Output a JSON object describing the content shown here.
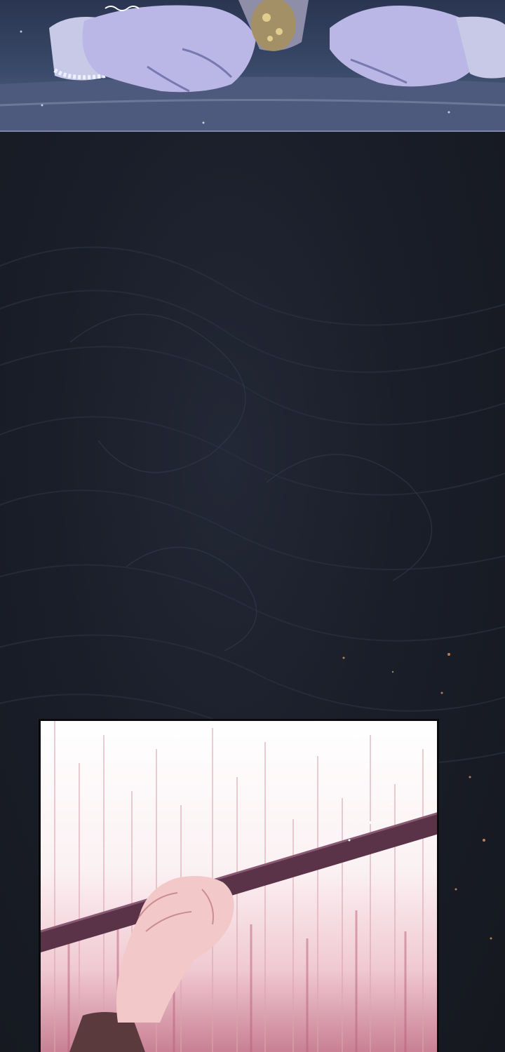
{
  "panels": [
    {
      "scene": "hands-on-table"
    },
    {
      "scene": "dark-swirl-background"
    },
    {
      "scene": "hand-gripping-staff"
    }
  ],
  "colors": {
    "night_blue": "#3a4a6a",
    "dark_bg": "#1a1e29",
    "panel_white": "#ffffff",
    "speed_line_pink": "#c98094",
    "staff_purple": "#5a3348",
    "skin": "#f2c9c8"
  }
}
